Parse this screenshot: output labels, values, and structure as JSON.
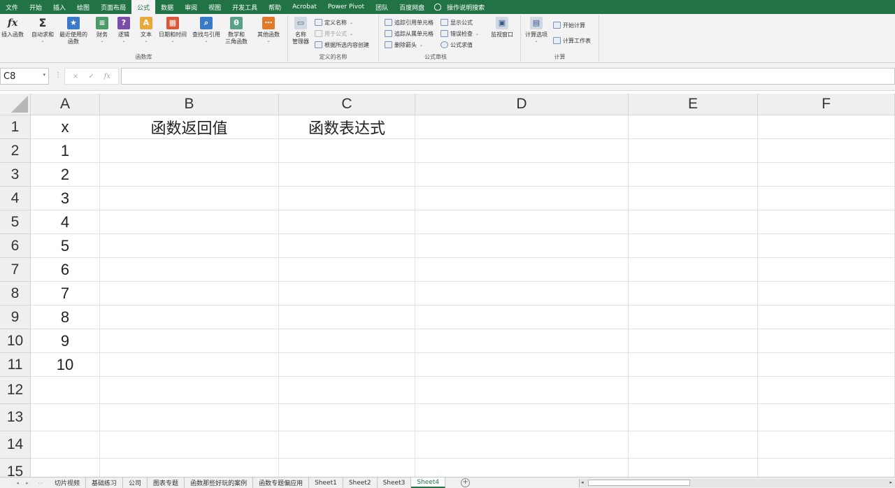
{
  "menu": {
    "tabs": [
      "文件",
      "开始",
      "插入",
      "绘图",
      "页面布局",
      "公式",
      "数据",
      "审阅",
      "视图",
      "开发工具",
      "帮助",
      "Acrobat",
      "Power Pivot",
      "团队",
      "百度网盘"
    ],
    "active_index": 5,
    "tell_me": "操作说明搜索"
  },
  "ribbon": {
    "function_library": {
      "label": "函数库",
      "insert_function": "插入函数",
      "autosum": "自动求和",
      "recent_line1": "最近使用的",
      "recent_line2": "函数",
      "financial": "财务",
      "logical": "逻辑",
      "text": "文本",
      "datetime": "日期和时间",
      "lookup": "查找与引用",
      "math_line1": "数学和",
      "math_line2": "三角函数",
      "more": "其他函数"
    },
    "defined_names": {
      "label": "定义的名称",
      "name_manager_line1": "名称",
      "name_manager_line2": "管理器",
      "define_name": "定义名称",
      "use_in_formula": "用于公式",
      "create_from_selection": "根据所选内容创建"
    },
    "formula_auditing": {
      "label": "公式审核",
      "trace_precedents": "追踪引用单元格",
      "trace_dependents": "追踪从属单元格",
      "remove_arrows": "删除箭头",
      "show_formulas": "显示公式",
      "error_checking": "错误检查",
      "evaluate_formula": "公式求值",
      "watch_window": "监视窗口"
    },
    "calculation": {
      "label": "计算",
      "calc_options": "计算选项",
      "calc_now": "开始计算",
      "calc_sheet": "计算工作表"
    }
  },
  "formula_bar": {
    "name_box": "C8",
    "cancel": "×",
    "enter": "✓",
    "fx": "fx",
    "content": ""
  },
  "sheet": {
    "columns": [
      "A",
      "B",
      "C",
      "D",
      "E",
      "F"
    ],
    "rows": [
      "1",
      "2",
      "3",
      "4",
      "5",
      "6",
      "7",
      "8",
      "9",
      "10",
      "11",
      "12",
      "13",
      "14",
      "15"
    ],
    "cells": {
      "A1": "x",
      "B1": "函数返回值",
      "C1": "函数表达式",
      "A2": "1",
      "A3": "2",
      "A4": "3",
      "A5": "4",
      "A6": "5",
      "A7": "6",
      "A8": "7",
      "A9": "8",
      "A10": "9",
      "A11": "10"
    }
  },
  "tabs": {
    "sheets": [
      "切片视频",
      "基础练习",
      "公司",
      "图表专题",
      "函数那些好玩的案例",
      "函数专题偏应用",
      "Sheet1",
      "Sheet2",
      "Sheet3",
      "Sheet4"
    ],
    "active": "Sheet4",
    "add": "+"
  },
  "icons": {
    "add_sheet": "plus-circle-icon",
    "tell_me": "lightbulb-icon"
  },
  "colors": {
    "accent": "#217346",
    "financial": "#4a9a6a",
    "logical": "#7a4ea8",
    "text": "#e8a83a",
    "datetime": "#d9583a",
    "lookup": "#3a7ac8",
    "math": "#5aa08a",
    "more": "#e07a2a"
  }
}
